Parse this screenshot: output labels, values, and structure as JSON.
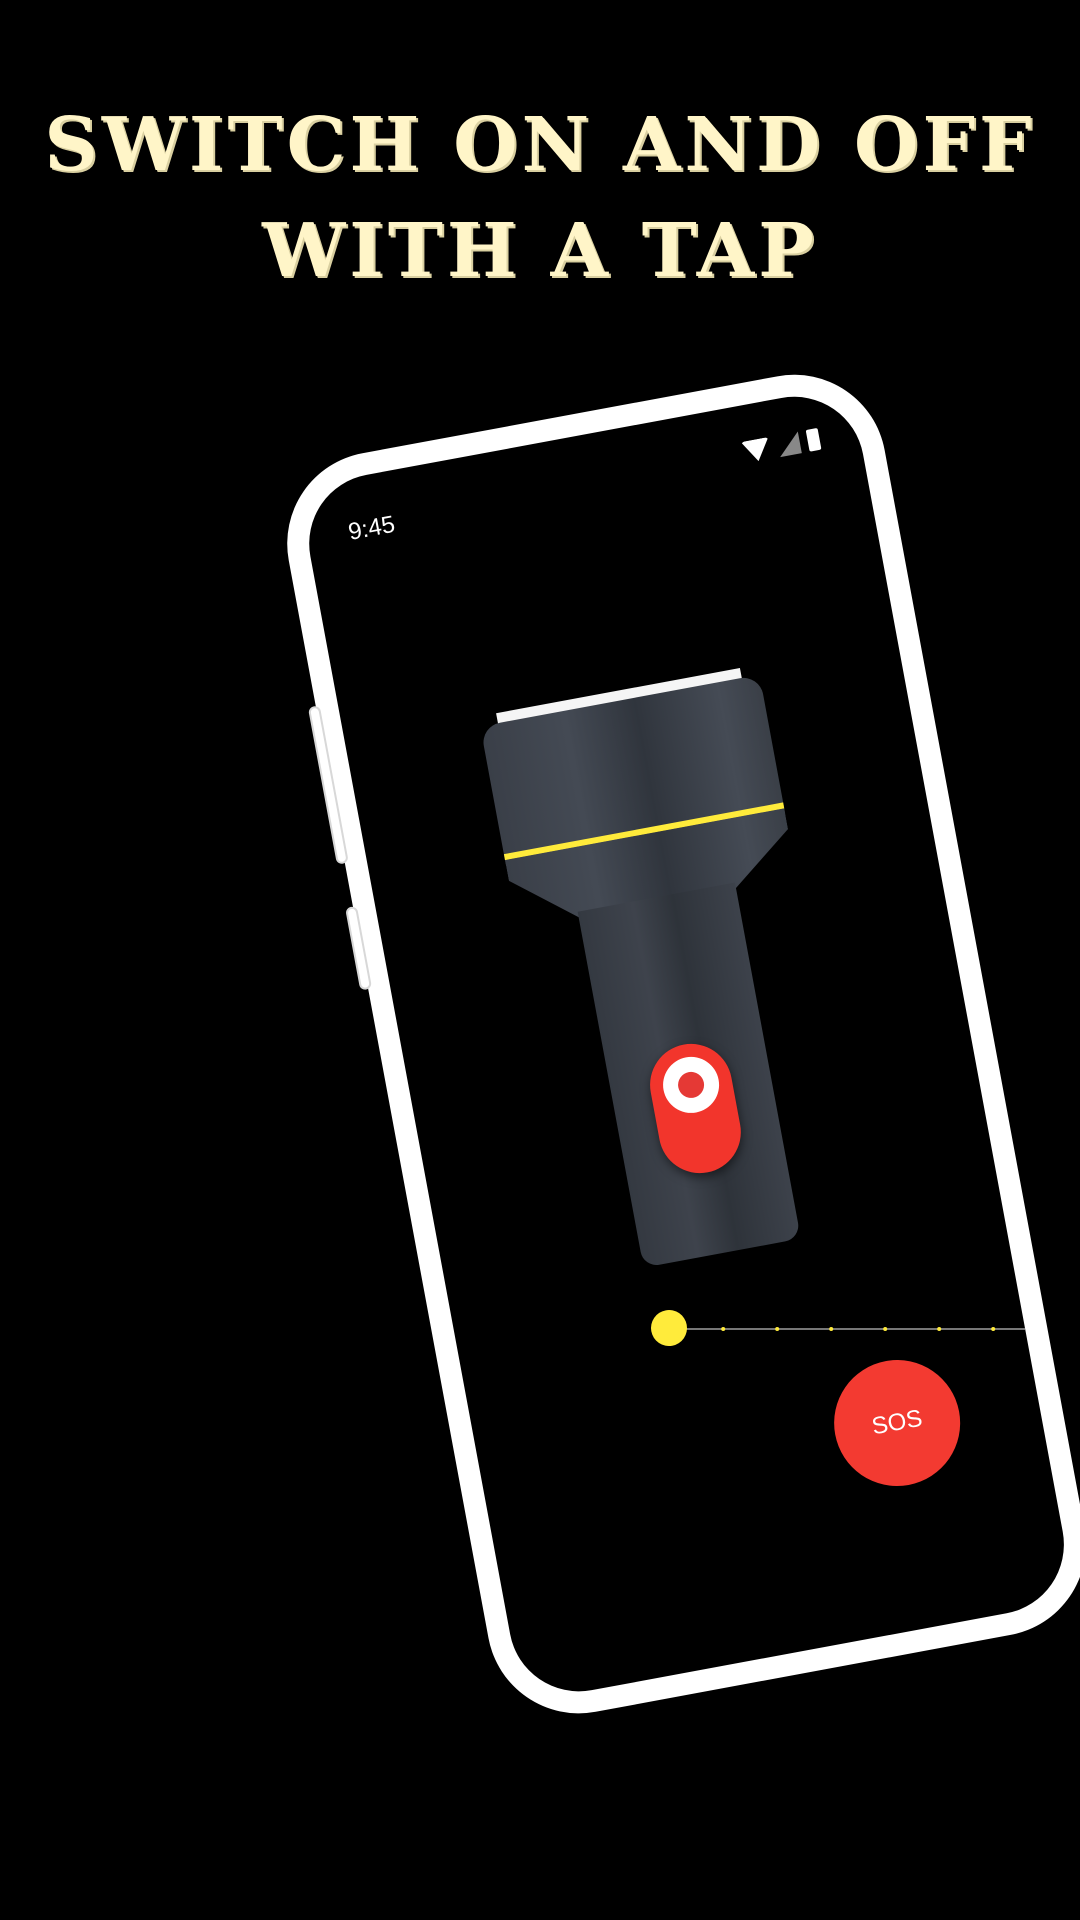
{
  "headline": {
    "line1": "SWITCH ON AND OFF",
    "line2": "WITH A TAP"
  },
  "status_bar": {
    "time": "9:45",
    "icons": [
      "wifi-icon",
      "signal-icon",
      "battery-icon"
    ]
  },
  "flashlight": {
    "state": "off",
    "accent_color": "#ffeb3b",
    "switch_color": "#f2352c"
  },
  "brightness_slider": {
    "value": 0,
    "steps": 10
  },
  "sos_button": {
    "label": "SOS"
  },
  "colors": {
    "headline": "#fff5c8",
    "background": "#000000",
    "phone_frame": "#ffffff",
    "sos": "#f33a31"
  }
}
